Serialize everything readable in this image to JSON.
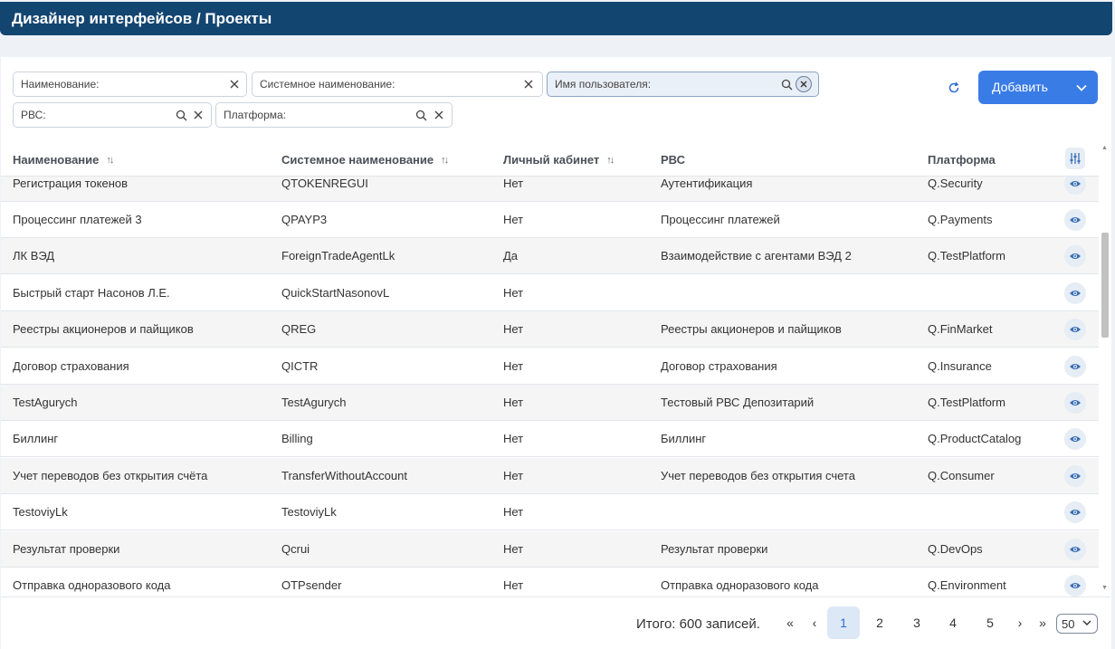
{
  "header": {
    "title": "Дизайнер интерфейсов / Проекты"
  },
  "filters": {
    "name": "Наименование:",
    "system_name": "Системное наименование:",
    "user_name": "Имя пользователя:",
    "rvs": "РВС:",
    "platform": "Платформа:"
  },
  "toolbar": {
    "add_label": "Добавить"
  },
  "table": {
    "columns": [
      "Наименование",
      "Системное наименование",
      "Личный кабинет",
      "РВС",
      "Платформа"
    ],
    "rows": [
      [
        "Регистрация токенов",
        "QTOKENREGUI",
        "Нет",
        "Аутентификация",
        "Q.Security"
      ],
      [
        "Процессинг платежей 3",
        "QPAYP3",
        "Нет",
        "Процессинг платежей",
        "Q.Payments"
      ],
      [
        "ЛК ВЭД",
        "ForeignTradeAgentLk",
        "Да",
        "Взаимодействие с агентами ВЭД 2",
        "Q.TestPlatform"
      ],
      [
        "Быстрый старт Насонов Л.Е.",
        "QuickStartNasonovL",
        "Нет",
        "",
        ""
      ],
      [
        "Реестры акционеров и пайщиков",
        "QREG",
        "Нет",
        "Реестры акционеров и пайщиков",
        "Q.FinMarket"
      ],
      [
        "Договор страхования",
        "QICTR",
        "Нет",
        "Договор страхования",
        "Q.Insurance"
      ],
      [
        "TestAgurych",
        "TestAgurych",
        "Нет",
        "Тестовый РВС Депозитарий",
        "Q.TestPlatform"
      ],
      [
        "Биллинг",
        "Billing",
        "Нет",
        "Биллинг",
        "Q.ProductCatalog"
      ],
      [
        "Учет переводов без открытия счёта",
        "TransferWithoutAccount",
        "Нет",
        "Учет переводов без открытия счета",
        "Q.Consumer"
      ],
      [
        "TestoviyLk",
        "TestoviyLk",
        "Нет",
        "",
        ""
      ],
      [
        "Результат проверки",
        "Qcrui",
        "Нет",
        "Результат проверки",
        "Q.DevOps"
      ],
      [
        "Отправка одноразового кода",
        "OTPsender",
        "Нет",
        "Отправка одноразового кода",
        "Q.Environment"
      ]
    ]
  },
  "pagination": {
    "total": "Итого: 600 записей.",
    "pages": [
      "1",
      "2",
      "3",
      "4",
      "5"
    ],
    "current": "1",
    "per_page": "50"
  },
  "colors": {
    "header_bg": "#134571",
    "accent": "#3a7ce6"
  }
}
